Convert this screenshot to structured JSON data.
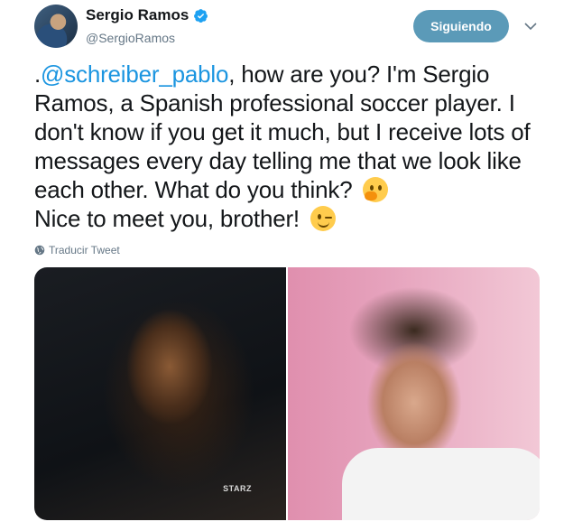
{
  "user": {
    "display_name": "Sergio Ramos",
    "handle": "@SergioRamos",
    "verified_icon": "verified-badge-icon",
    "avatar_icon": "avatar"
  },
  "follow_button": {
    "label": "Siguiendo",
    "color": "#5b9ab8"
  },
  "menu_icon": "chevron-down-icon",
  "tweet": {
    "prefix": ".",
    "mention": "@schreiber_pablo",
    "body_1": ", how are you? I'm Sergio Ramos, a Spanish professional soccer player. I don't know if you get it much, but I receive lots of messages every day telling me that we look like each other. What do you think?",
    "emoji_1": "thinking-face-emoji",
    "body_2": "Nice to meet you, brother!",
    "emoji_2": "winking-face-emoji"
  },
  "translate": {
    "label": "Traducir Tweet",
    "icon": "globe-icon"
  },
  "media": {
    "left_watermark": "STARZ"
  },
  "colors": {
    "link": "#1b95e0",
    "secondary_text": "#657786",
    "primary_text": "#14171a"
  }
}
